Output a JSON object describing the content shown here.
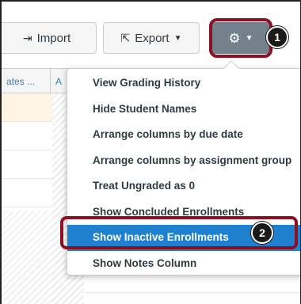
{
  "toolbar": {
    "import_label": "Import",
    "import_icon": "import-icon",
    "export_label": "Export",
    "export_icon": "export-icon",
    "export_caret": "▼",
    "gear_icon": "gear-icon",
    "gear_caret": "▼"
  },
  "grid": {
    "columns": [
      "ates ...",
      "A"
    ]
  },
  "menu": {
    "items": [
      "View Grading History",
      "Hide Student Names",
      "Arrange columns by due date",
      "Arrange columns by assignment group",
      "Treat Ungraded as 0",
      "Show Concluded Enrollments",
      "Show Inactive Enrollments",
      "Show Notes Column"
    ],
    "active_index": 6
  },
  "annotations": {
    "step1": "1",
    "step2": "2"
  },
  "colors": {
    "accent": "#1f80cf",
    "highlight_outline": "#8e1020",
    "gear_button": "#73818c"
  }
}
